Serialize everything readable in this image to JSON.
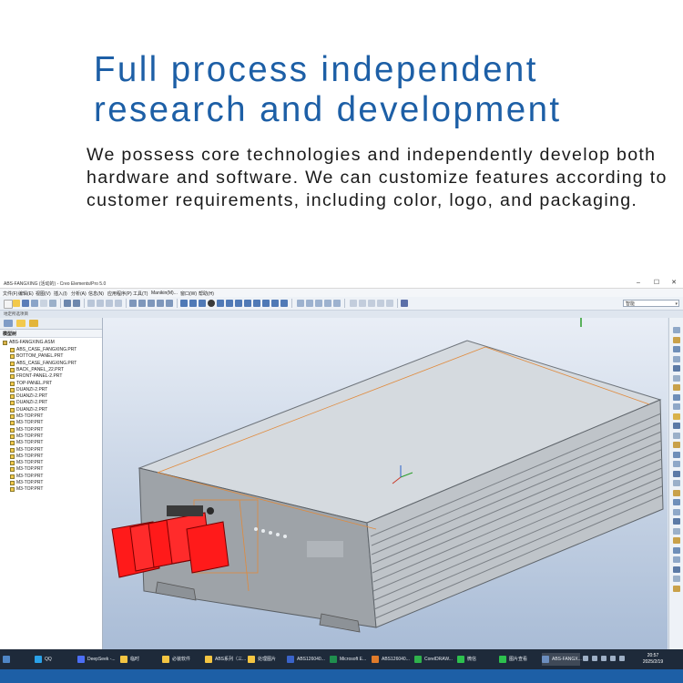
{
  "heading": "Full process independent research and development",
  "intro": "We possess core technologies and independently develop both hardware and software. We can customize features according to customer requirements, including color, logo, and packaging.",
  "window": {
    "title": "ABS-FANGXING (活动的) - Creo Elements/Pro 5.0",
    "minimize": "–",
    "maximize": "☐",
    "close": "✕"
  },
  "menu": [
    "文件(F)",
    "编辑(E)",
    "视图(V)",
    "插入(I)",
    "分析(A)",
    "信息(N)",
    "应用程序(P)",
    "工具(T)",
    "Manikin(M)...",
    "窗口(W)",
    "帮助(H)"
  ],
  "search": {
    "value": "智能"
  },
  "status_strip": "地定所选项目",
  "model_tree": {
    "header": "模型树",
    "root": "ABS-FANGXING.ASM",
    "items": [
      "ABS_CASE_FANGXING.PRT",
      "BOTTOM_PANEL.PRT",
      "ABS_CASE_FANGXING.PRT",
      "BACK_PANEL_22.PRT",
      "FRONT-PANEL-2.PRT",
      "TOP-PANEL.PRT",
      "DUANZI-2.PRT",
      "DUANZI-2.PRT",
      "DUANZI-2.PRT",
      "DUANZI-2.PRT",
      "M3-TOP.PRT",
      "M3-TOP.PRT",
      "M3-TOP.PRT",
      "M3-TOP.PRT",
      "M3-TOP.PRT",
      "M3-TOP.PRT",
      "M3-TOP.PRT",
      "M3-TOP.PRT",
      "M3-TOP.PRT",
      "M3-TOP.PRT",
      "M3-TOP.PRT",
      "M3-TOP.PRT"
    ]
  },
  "taskbar": {
    "items": [
      {
        "label": "QQ",
        "color": "#2aa1e8"
      },
      {
        "label": "DeepSeek -...",
        "color": "#4c6ef5"
      },
      {
        "label": "临时",
        "color": "#f4c542"
      },
      {
        "label": "必装软件",
        "color": "#f4c542"
      },
      {
        "label": "ABS系列（三...",
        "color": "#f4c542"
      },
      {
        "label": "处理图片",
        "color": "#f4c542"
      },
      {
        "label": "ABS126040...",
        "color": "#3a63c9"
      },
      {
        "label": "Microsoft E...",
        "color": "#1f8f4e"
      },
      {
        "label": "ABS126040...",
        "color": "#e07b2a"
      },
      {
        "label": "CorelDRAW...",
        "color": "#2fb24c"
      },
      {
        "label": "微信",
        "color": "#2dc14e"
      },
      {
        "label": "图片查看",
        "color": "#2dc14e"
      },
      {
        "label": "ABS-FANGX...",
        "color": "#6c8ebf"
      }
    ],
    "time": "20:57",
    "date": "2025/2/19"
  },
  "colors": {
    "heading": "#1d5fa6",
    "brand_band": "#1d5fa6",
    "part_highlight": "#ff1a1a"
  }
}
